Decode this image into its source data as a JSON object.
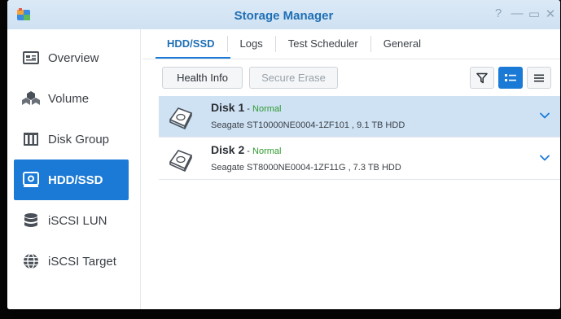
{
  "window": {
    "title": "Storage Manager",
    "help_label": "?",
    "minimize_label": "—",
    "maximize_label": "▭",
    "close_label": "✕"
  },
  "sidebar": {
    "items": [
      {
        "label": "Overview",
        "icon": "overview-icon",
        "active": false
      },
      {
        "label": "Volume",
        "icon": "volume-icon",
        "active": false
      },
      {
        "label": "Disk Group",
        "icon": "disk-group-icon",
        "active": false
      },
      {
        "label": "HDD/SSD",
        "icon": "hdd-icon",
        "active": true
      },
      {
        "label": "iSCSI LUN",
        "icon": "iscsi-lun-icon",
        "active": false
      },
      {
        "label": "iSCSI Target",
        "icon": "globe-icon",
        "active": false
      }
    ]
  },
  "tabs": [
    {
      "label": "HDD/SSD",
      "active": true
    },
    {
      "label": "Logs",
      "active": false
    },
    {
      "label": "Test Scheduler",
      "active": false
    },
    {
      "label": "General",
      "active": false
    }
  ],
  "toolbar": {
    "health_info_label": "Health Info",
    "secure_erase_label": "Secure Erase",
    "filter_icon": "filter-icon",
    "detail_view_icon": "detail-list-icon",
    "list_view_icon": "list-icon"
  },
  "disks": [
    {
      "name": "Disk 1",
      "separator": " - ",
      "status": "Normal",
      "detail": "Seagate ST10000NE0004-1ZF101 , 9.1 TB HDD",
      "selected": true
    },
    {
      "name": "Disk 2",
      "separator": " - ",
      "status": "Normal",
      "detail": "Seagate ST8000NE0004-1ZF11G , 7.3 TB HDD",
      "selected": false
    }
  ],
  "colors": {
    "accent": "#1a7ad6",
    "title": "#1f6fb4",
    "status_normal": "#2f9a2f",
    "selected_row": "#cfe2f4"
  }
}
